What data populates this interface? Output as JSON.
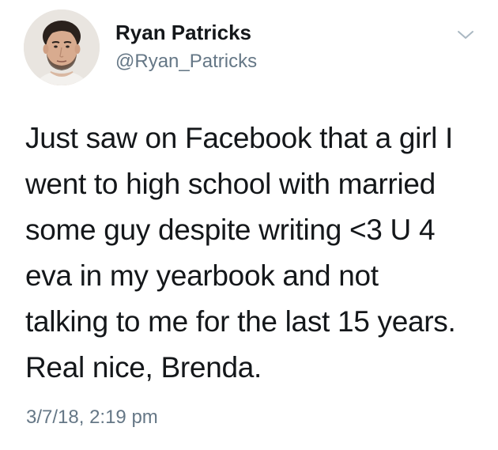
{
  "author": {
    "display_name": "Ryan Patricks",
    "handle": "@Ryan_Patricks"
  },
  "menu": {
    "icon": "chevron-down-icon"
  },
  "tweet": {
    "lines": [
      "Just saw on Facebook that a girl I",
      "went to high school with married",
      "some guy despite writing <3 U 4",
      "eva in my yearbook and not",
      "talking to me for the last 15 years.",
      "Real nice, Brenda."
    ],
    "timestamp": "3/7/18, 2:19 pm"
  },
  "colors": {
    "text": "#14171a",
    "secondary": "#657786",
    "background": "#ffffff"
  }
}
